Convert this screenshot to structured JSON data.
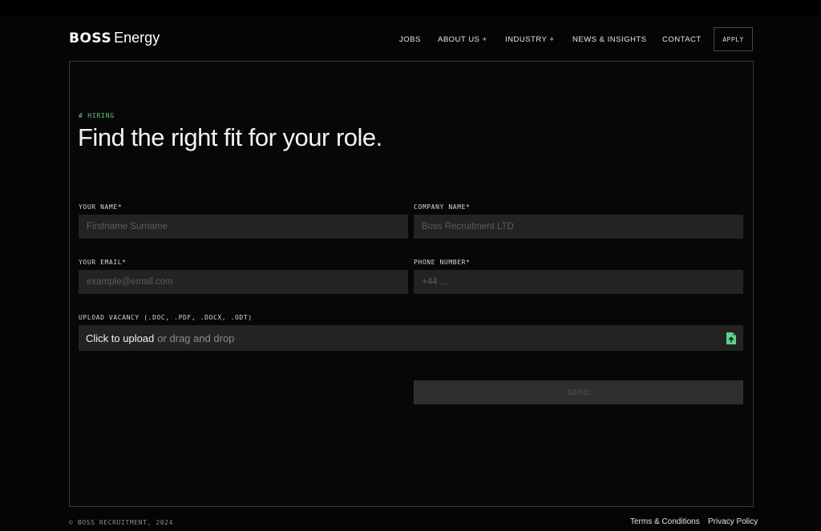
{
  "brand": {
    "bold": "BOSS",
    "light": "Energy"
  },
  "nav": {
    "items": [
      {
        "label": "JOBS"
      },
      {
        "label": "ABOUT US +"
      },
      {
        "label": "INDUSTRY +"
      },
      {
        "label": "NEWS & INSIGHTS"
      },
      {
        "label": "CONTACT"
      }
    ],
    "apply_label": "APPLY"
  },
  "hero": {
    "tag": "# HIRING",
    "title": "Find the right fit for your role."
  },
  "form": {
    "name": {
      "label": "YOUR NAME*",
      "placeholder": "Firstname Surname"
    },
    "company": {
      "label": "COMPANY NAME*",
      "placeholder": "Boss Recruitment LTD"
    },
    "email": {
      "label": "YOUR EMAIL*",
      "placeholder": "example@email.com"
    },
    "phone": {
      "label": "PHONE NUMBER*",
      "placeholder": "+44 ..."
    },
    "upload": {
      "label": "UPLOAD VACANCY (.DOC, .PDF, .DOCX, .ODT)",
      "primary": "Click to upload",
      "secondary": "or drag and drop",
      "icon": "file-upload-icon"
    },
    "submit_label": "SEND"
  },
  "footer": {
    "copyright": "© BOSS RECRUITMENT, 2024",
    "links": [
      {
        "label": "Terms & Conditions"
      },
      {
        "label": "Privacy Policy"
      }
    ]
  },
  "colors": {
    "background": "#050505",
    "accent": "#63c987",
    "field": "#232323",
    "border": "#3a3a3a"
  }
}
